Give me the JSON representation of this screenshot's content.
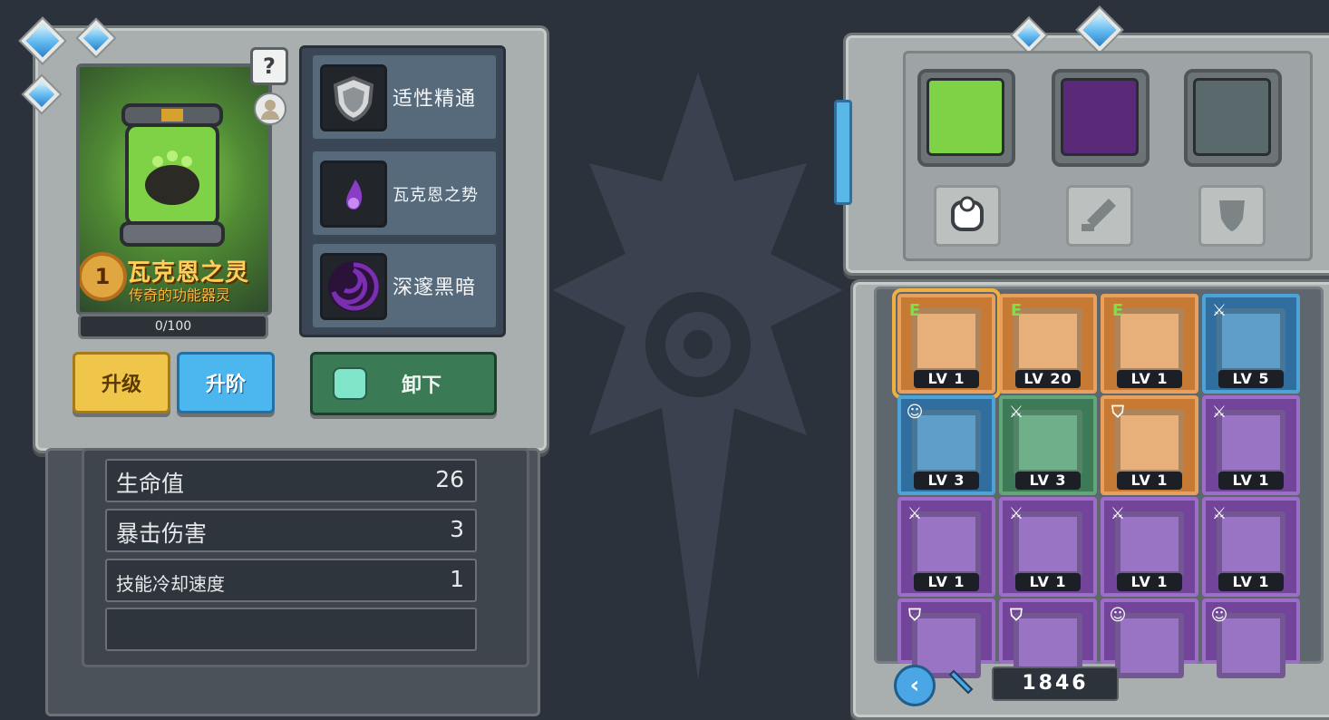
{
  "spirit": {
    "rank": "1",
    "name": "瓦克恩之灵",
    "subtitle": "传奇的功能器灵",
    "xp": "0/100",
    "help": "?"
  },
  "skills": [
    {
      "label": "适性精通",
      "icon": "shield-icon"
    },
    {
      "label": "瓦克恩之势",
      "icon": "purple-flame-icon"
    },
    {
      "label": "深邃黑暗",
      "icon": "dark-vortex-icon"
    }
  ],
  "buttons": {
    "upgrade": "升级",
    "advance": "升阶",
    "unequip": "卸下"
  },
  "stats": [
    {
      "label": "生命值",
      "value": "26"
    },
    {
      "label": "暴击伤害",
      "value": "3"
    },
    {
      "label": "技能冷却速度",
      "value": "1"
    }
  ],
  "inventory": {
    "tabs": [
      "canister-spirit-icon",
      "purple-wizard-icon",
      "spiked-helmet-icon"
    ],
    "filters": [
      "spirit-filter-icon",
      "sword-filter-icon",
      "shield-filter-icon"
    ],
    "items": [
      {
        "lv": "LV 1",
        "tag": "E",
        "rarity": "orange",
        "icon": "canister-spirit-icon"
      },
      {
        "lv": "LV 20",
        "tag": "E",
        "rarity": "orange",
        "icon": "purple-wizard-icon"
      },
      {
        "lv": "LV 1",
        "tag": "E",
        "rarity": "orange",
        "icon": "spiked-helmet-icon"
      },
      {
        "lv": "LV 5",
        "tag": "⚔",
        "rarity": "blue",
        "icon": "armored-knight-icon"
      },
      {
        "lv": "LV 3",
        "tag": "☺",
        "rarity": "blue",
        "icon": "fire-golem-icon"
      },
      {
        "lv": "LV 3",
        "tag": "⚔",
        "rarity": "green",
        "icon": "rock-golem-icon"
      },
      {
        "lv": "LV 1",
        "tag": "⛉",
        "rarity": "orange",
        "icon": "ice-knight-icon"
      },
      {
        "lv": "LV 1",
        "tag": "⚔",
        "rarity": "purple",
        "icon": "cannon-icon"
      },
      {
        "lv": "LV 1",
        "tag": "⚔",
        "rarity": "purple",
        "icon": "lava-beast-icon"
      },
      {
        "lv": "LV 1",
        "tag": "⚔",
        "rarity": "purple",
        "icon": "frost-yeti-icon"
      },
      {
        "lv": "LV 1",
        "tag": "⚔",
        "rarity": "purple",
        "icon": "water-spirit-icon"
      },
      {
        "lv": "LV 1",
        "tag": "⚔",
        "rarity": "purple",
        "icon": "gold-beast-icon"
      },
      {
        "lv": "",
        "tag": "⛉",
        "rarity": "purple",
        "icon": "dark-knight-icon"
      },
      {
        "lv": "",
        "tag": "⛉",
        "rarity": "purple",
        "icon": "brown-beast-icon"
      },
      {
        "lv": "",
        "tag": "☺",
        "rarity": "purple",
        "icon": "bear-icon"
      },
      {
        "lv": "",
        "tag": "☺",
        "rarity": "purple",
        "icon": "tank-icon"
      }
    ],
    "currency": "1846"
  },
  "colors": {
    "orange": "#c77a34",
    "blue": "#2f6e9e",
    "green": "#3f7a58",
    "purple": "#72459a",
    "accent_gold": "#f0c64a",
    "accent_blue": "#4cb6ee",
    "unequip_green": "#3a7a54"
  }
}
